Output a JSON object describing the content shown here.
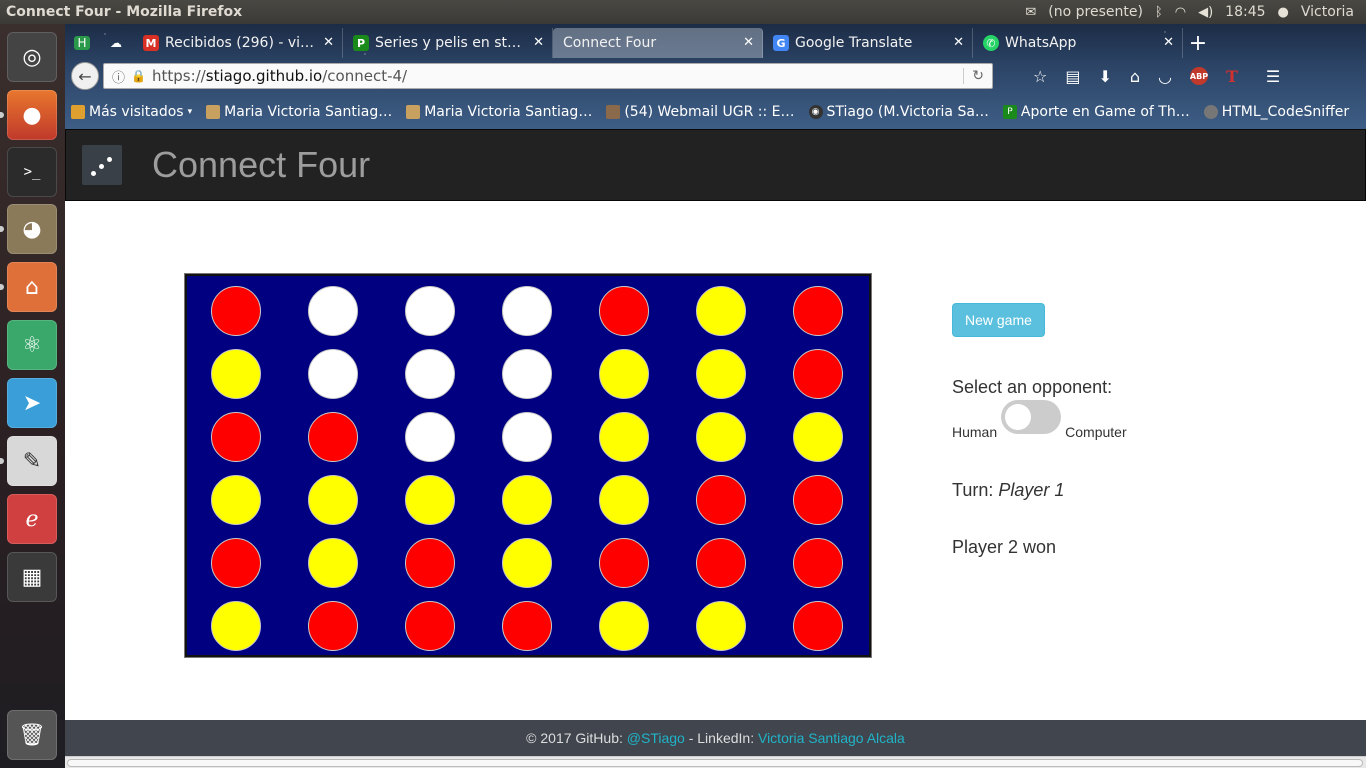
{
  "system": {
    "window_title": "Connect Four - Mozilla Firefox",
    "presence": "(no presente)",
    "time": "18:45",
    "user": "Victoria"
  },
  "tabs": [
    {
      "label": "Recibidos (296) - vic…",
      "icon": "gmail-icon",
      "color": "#d93025",
      "active": false
    },
    {
      "label": "Series y pelis en stre…",
      "icon": "pelis-icon",
      "color": "#1a8a1a",
      "active": false
    },
    {
      "label": "Connect Four",
      "icon": "",
      "color": "",
      "active": true
    },
    {
      "label": "Google Translate",
      "icon": "translate-icon",
      "color": "#4285f4",
      "active": false
    },
    {
      "label": "WhatsApp",
      "icon": "whatsapp-icon",
      "color": "#25d366",
      "active": false
    }
  ],
  "url": {
    "scheme": "https://",
    "host": "stiago.github.io",
    "path": "/connect-4/"
  },
  "bookmarks": [
    {
      "label": "Más visitados",
      "color": "#e0a030"
    },
    {
      "label": "Maria Victoria Santiag…",
      "color": "#c8a060"
    },
    {
      "label": "Maria Victoria Santiag…",
      "color": "#c8a060"
    },
    {
      "label": "(54) Webmail UGR :: E…",
      "color": "#8a6a4a"
    },
    {
      "label": "STiago (M.Victoria Sa…",
      "color": "#333333"
    },
    {
      "label": "Aporte en Game of Th…",
      "color": "#1a8a1a"
    },
    {
      "label": "HTML_CodeSniffer",
      "color": "#777777"
    }
  ],
  "site": {
    "title": "Connect Four"
  },
  "board": {
    "rows": 6,
    "cols": 7,
    "background": "#000080",
    "colors": {
      "R": "#ff0000",
      "Y": "#ffff00",
      "W": "#ffffff"
    },
    "cells": [
      [
        "R",
        "W",
        "W",
        "W",
        "R",
        "Y",
        "R"
      ],
      [
        "Y",
        "W",
        "W",
        "W",
        "Y",
        "Y",
        "R"
      ],
      [
        "R",
        "R",
        "W",
        "W",
        "Y",
        "Y",
        "Y"
      ],
      [
        "Y",
        "Y",
        "Y",
        "Y",
        "Y",
        "R",
        "R"
      ],
      [
        "R",
        "Y",
        "R",
        "Y",
        "R",
        "R",
        "R"
      ],
      [
        "Y",
        "R",
        "R",
        "R",
        "Y",
        "Y",
        "R"
      ]
    ]
  },
  "controls": {
    "new_game": "New game",
    "select_opponent": "Select an opponent:",
    "human": "Human",
    "computer": "Computer",
    "turn_label": "Turn:",
    "turn_value": "Player 1",
    "result": "Player 2 won"
  },
  "footer": {
    "prefix": "© 2017 GitHub: ",
    "github_link": "@STiago",
    "middle": " - LinkedIn: ",
    "linkedin_link": "Victoria Santiago Alcala"
  }
}
